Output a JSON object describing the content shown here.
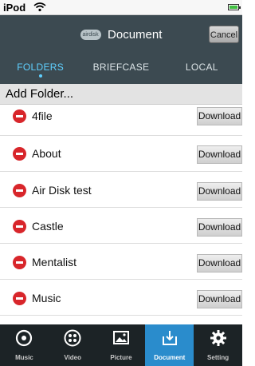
{
  "status_bar": {
    "carrier": "iPod"
  },
  "header": {
    "logo_text": "airdisk",
    "title": "Document",
    "cancel_label": "Cancel",
    "tabs": [
      {
        "label": "FOLDERS",
        "active": true
      },
      {
        "label": "BRIEFCASE",
        "active": false
      },
      {
        "label": "LOCAL",
        "active": false
      }
    ]
  },
  "add_folder": {
    "label": "Add Folder..."
  },
  "folders": [
    {
      "name": "4file",
      "action": "Download"
    },
    {
      "name": "About",
      "action": "Download"
    },
    {
      "name": "Air Disk test",
      "action": "Download"
    },
    {
      "name": "Castle",
      "action": "Download"
    },
    {
      "name": "Mentalist",
      "action": "Download"
    },
    {
      "name": "Music",
      "action": "Download"
    }
  ],
  "tab_bar": [
    {
      "label": "Music",
      "icon": "music-icon",
      "active": false
    },
    {
      "label": "Video",
      "icon": "video-icon",
      "active": false
    },
    {
      "label": "Picture",
      "icon": "picture-icon",
      "active": false
    },
    {
      "label": "Document",
      "icon": "document-icon",
      "active": true
    },
    {
      "label": "Setting",
      "icon": "gear-icon",
      "active": false
    }
  ],
  "colors": {
    "header_bg": "#3c4a51",
    "active_tab": "#5fd0ff",
    "delete_red": "#d8262b",
    "tabbar_bg": "#1c2326",
    "tabbar_active": "#2a8ccc"
  }
}
